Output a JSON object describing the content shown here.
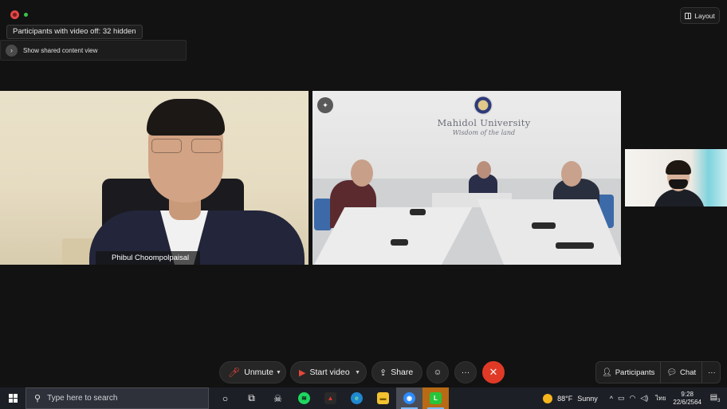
{
  "topbar": {
    "hidden_participants_text": "Participants with video off: 32 hidden",
    "shared_content_label": "Show shared content view",
    "layout_label": "Layout"
  },
  "tiles": {
    "speaker_name": "Phibul Choompolpaisal",
    "room_university_name": "Mahidol University",
    "room_university_motto": "Wisdom of the land"
  },
  "toolbar": {
    "unmute_label": "Unmute",
    "start_video_label": "Start video",
    "share_label": "Share",
    "participants_label": "Participants",
    "chat_label": "Chat",
    "more_glyph": "···",
    "leave_glyph": "✕"
  },
  "taskbar": {
    "search_placeholder": "Type here to search",
    "weather_temp": "88°F",
    "weather_text": "Sunny",
    "lang": "ไทย",
    "time": "9:28",
    "date": "22/6/2564",
    "notification_count": "3"
  },
  "colors": {
    "leave_red": "#e03a26",
    "muted_red": "#e5473a",
    "app_bg": "#121212"
  }
}
